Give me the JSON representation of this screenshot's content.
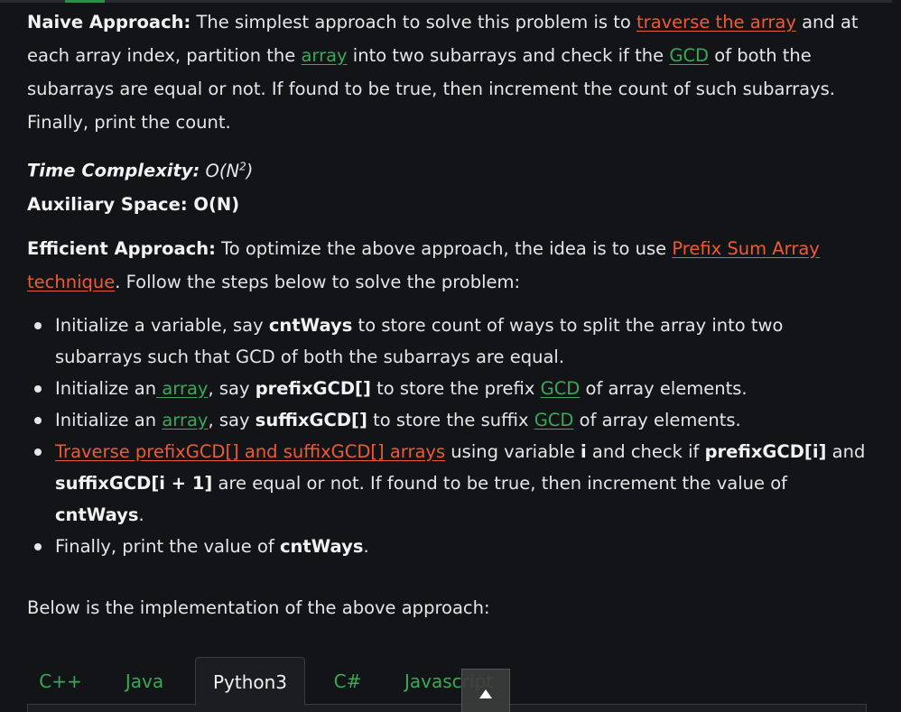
{
  "naive": {
    "label": "Naive Approach:",
    "t1": " The simplest approach to solve this problem is to ",
    "link1": "traverse the array",
    "t2": " and at each array index, partition the ",
    "link2": "array",
    "t3": " into two subarrays and check if the ",
    "link3": "GCD",
    "t4": " of both the subarrays are equal or not. If found to be true, then increment the count of such subarrays. Finally, print the count."
  },
  "time": {
    "label": "Time Complexity:",
    "value": " O(N",
    "sup": "2",
    "close": ")"
  },
  "space": {
    "label": "Auxiliary Space: O(N)"
  },
  "efficient": {
    "label": "Efficient Approach:",
    "t1": " To optimize the above approach, the idea is to use ",
    "link1": "Prefix Sum Array technique",
    "t2": ". Follow the steps below to solve the problem:"
  },
  "steps": {
    "s1": {
      "a": "Initialize a variable, say ",
      "b": "cntWays",
      "c": " to store count of ways to split the array into two subarrays such that GCD of both the subarrays are equal."
    },
    "s2": {
      "a": "Initialize an",
      "link1": " array",
      "b": ", say ",
      "c": "prefixGCD[]",
      "d": " to store the prefix ",
      "link2": "GCD",
      "e": " of array elements."
    },
    "s3": {
      "a": "Initialize an ",
      "link1": "array",
      "b": ", say ",
      "c": "suffixGCD[]",
      "d": " to store the suffix ",
      "link2": "GCD",
      "e": " of array elements."
    },
    "s4": {
      "link1": "Traverse prefixGCD[] and suffixGCD[] arrays",
      "a": " using variable ",
      "b": "i",
      "c": " and check if ",
      "d": "prefixGCD[i]",
      "e": " and ",
      "f": "suffixGCD[i + 1]",
      "g": " are equal or not. If found to be true, then increment the value of ",
      "h": "cntWays",
      "i": "."
    },
    "s5": {
      "a": "Finally, print the value of ",
      "b": "cntWays",
      "c": "."
    }
  },
  "below": "Below is the implementation of the above approach:",
  "tabs": [
    "C++",
    "Java",
    "Python3",
    "C#",
    "Javascript"
  ],
  "active_tab": "Python3",
  "icons": {
    "scroll_top": "chevron-up-icon"
  },
  "colors": {
    "background": "#131417",
    "text": "#e6e6e6",
    "red_link": "#ef5a36",
    "green_link": "#3aa857"
  }
}
